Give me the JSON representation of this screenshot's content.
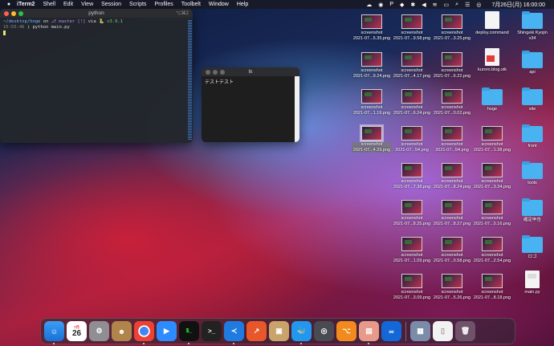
{
  "menubar": {
    "apple": "",
    "items": [
      "iTerm2",
      "Shell",
      "Edit",
      "View",
      "Session",
      "Scripts",
      "Profiles",
      "Toolbelt",
      "Window",
      "Help"
    ],
    "clock": "7月26日(月) 16:00:00"
  },
  "terminal": {
    "title": "python",
    "shortcut": "⌥⌘2",
    "line1_path": "~/desktop/hoge",
    "line1_on": "on",
    "line1_branch": "master [!]",
    "line1_via": "via",
    "line1_version": "v3.9.1",
    "line2_time": "15:55:46",
    "line2_prompt": "❯",
    "line2_cmd": "python main.py"
  },
  "tk": {
    "title": "tk",
    "text": "テストテスト"
  },
  "icons": [
    {
      "l1": "screenshot",
      "l2": "2021-07...5.35.png"
    },
    {
      "l1": "screenshot",
      "l2": "2021-07...9.58.png"
    },
    {
      "l1": "screenshot",
      "l2": "2021-07...3.25.png"
    },
    {
      "l1": "deploy.command",
      "l2": ""
    },
    {
      "l1": "Shingeki Kyojin",
      "l2": "v34"
    },
    {
      "l1": "screenshot",
      "l2": "2021-07...9.24.png"
    },
    {
      "l1": "screenshot",
      "l2": "2021-07...4.17.png"
    },
    {
      "l1": "screenshot",
      "l2": "2021-07...6.22.png"
    },
    {
      "l1": "kuroro.blog.stk",
      "l2": ""
    },
    {
      "l1": "api",
      "l2": ""
    },
    {
      "l1": "screenshot",
      "l2": "2021-07...1.19.png"
    },
    {
      "l1": "screenshot",
      "l2": "2021-07...6.24.png"
    },
    {
      "l1": "screenshot",
      "l2": "2021-07...0.02.png"
    },
    {
      "l1": "hoge",
      "l2": ""
    },
    {
      "l1": "site",
      "l2": ""
    },
    {
      "l1": "screenshot",
      "l2": "2021-07...4.29.png"
    },
    {
      "l1": "screenshot",
      "l2": "2021-07...54.png"
    },
    {
      "l1": "screenshot",
      "l2": "2021-07...54.png"
    },
    {
      "l1": "screenshot",
      "l2": "2021-07...1.38.png"
    },
    {
      "l1": "front",
      "l2": ""
    },
    {
      "l1": "screenshot",
      "l2": "2021-07...7.38.png"
    },
    {
      "l1": "screenshot",
      "l2": "2021-07...8.24.png"
    },
    {
      "l1": "screenshot",
      "l2": "2021-07...3.34.png"
    },
    {
      "l1": "tools",
      "l2": ""
    },
    {
      "l1": "screenshot",
      "l2": "2021-07...8.25.png"
    },
    {
      "l1": "screenshot",
      "l2": "2021-07...8.27.png"
    },
    {
      "l1": "screenshot",
      "l2": "2021-07...0.16.png"
    },
    {
      "l1": "確定申告",
      "l2": ""
    },
    {
      "l1": "screenshot",
      "l2": "2021-07...1.09.png"
    },
    {
      "l1": "screenshot",
      "l2": "2021-07...0.58.png"
    },
    {
      "l1": "screenshot",
      "l2": "2021-07...2.54.png"
    },
    {
      "l1": "ロゴ",
      "l2": ""
    },
    {
      "l1": "screenshot",
      "l2": "2021-07...3.09.png"
    },
    {
      "l1": "screenshot",
      "l2": "2021-07...5.26.png"
    },
    {
      "l1": "screenshot",
      "l2": "2021-07...8.18.png"
    },
    {
      "l1": "main.py",
      "l2": ""
    }
  ],
  "dock": {
    "calendar_month": "7月",
    "calendar_day": "26",
    "terminal_glyph": ">_"
  }
}
